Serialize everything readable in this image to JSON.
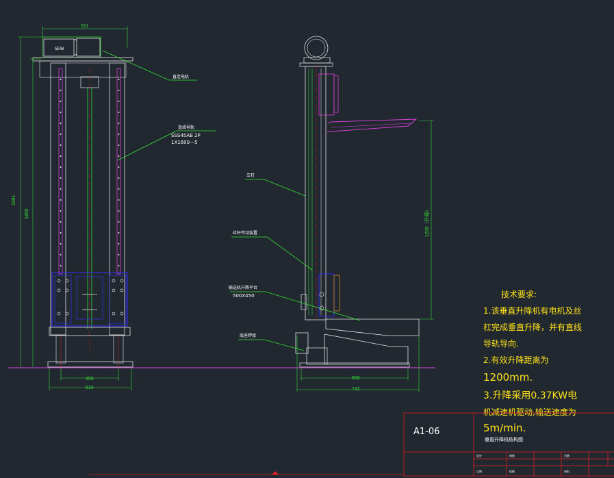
{
  "colors": {
    "background": "#212830",
    "outline": "#e8e8e8",
    "dimension": "#34e034",
    "leader": "#34e034",
    "magenta": "#e040e0",
    "blue": "#3030e0",
    "red": "#e02020",
    "notes": "#ffe21a"
  },
  "front_view": {
    "motor_label": "SEW",
    "dim_top_width": "511",
    "dim_overall_height": "1991",
    "dim_rail_height": "1850",
    "dim_inner_width": "350",
    "dim_base_width": "510",
    "leader_motor": "直连电机",
    "leader_rail_title": "直线导轨",
    "leader_rail_spec1": "SSS45AB 2P",
    "leader_rail_spec2": "1X1600—5"
  },
  "side_view": {
    "dim_stroke": "1200（升降）",
    "dim_base_inner": "600",
    "dim_base_outer": "732",
    "leader_column": "立柱",
    "leader_screw": "丝杆传动装置",
    "leader_platform": "输送机升降平台",
    "leader_platform_size": "500X450",
    "leader_base": "底座焊接"
  },
  "notes": {
    "heading": "技术要求:",
    "line1": "1.该垂直升降机有电机及丝",
    "line2": "杠完成垂直升降，并有直线",
    "line3": "导轨导向.",
    "line4": "2.有效升降距离为",
    "line5": "1200mm.",
    "line6": "3.升降采用0.37KW电",
    "line7": "机减速机驱动,输送速度为",
    "line8": "5m/min."
  },
  "title_block": {
    "drawing_no": "A1-06",
    "drawing_name": "垂直升降机结构图",
    "row1_label": "设计",
    "row1_label2": "审核",
    "row1_label3": "日期",
    "row2_label": "比例",
    "row2_label2": "张数",
    "row2_label3": "材料"
  }
}
